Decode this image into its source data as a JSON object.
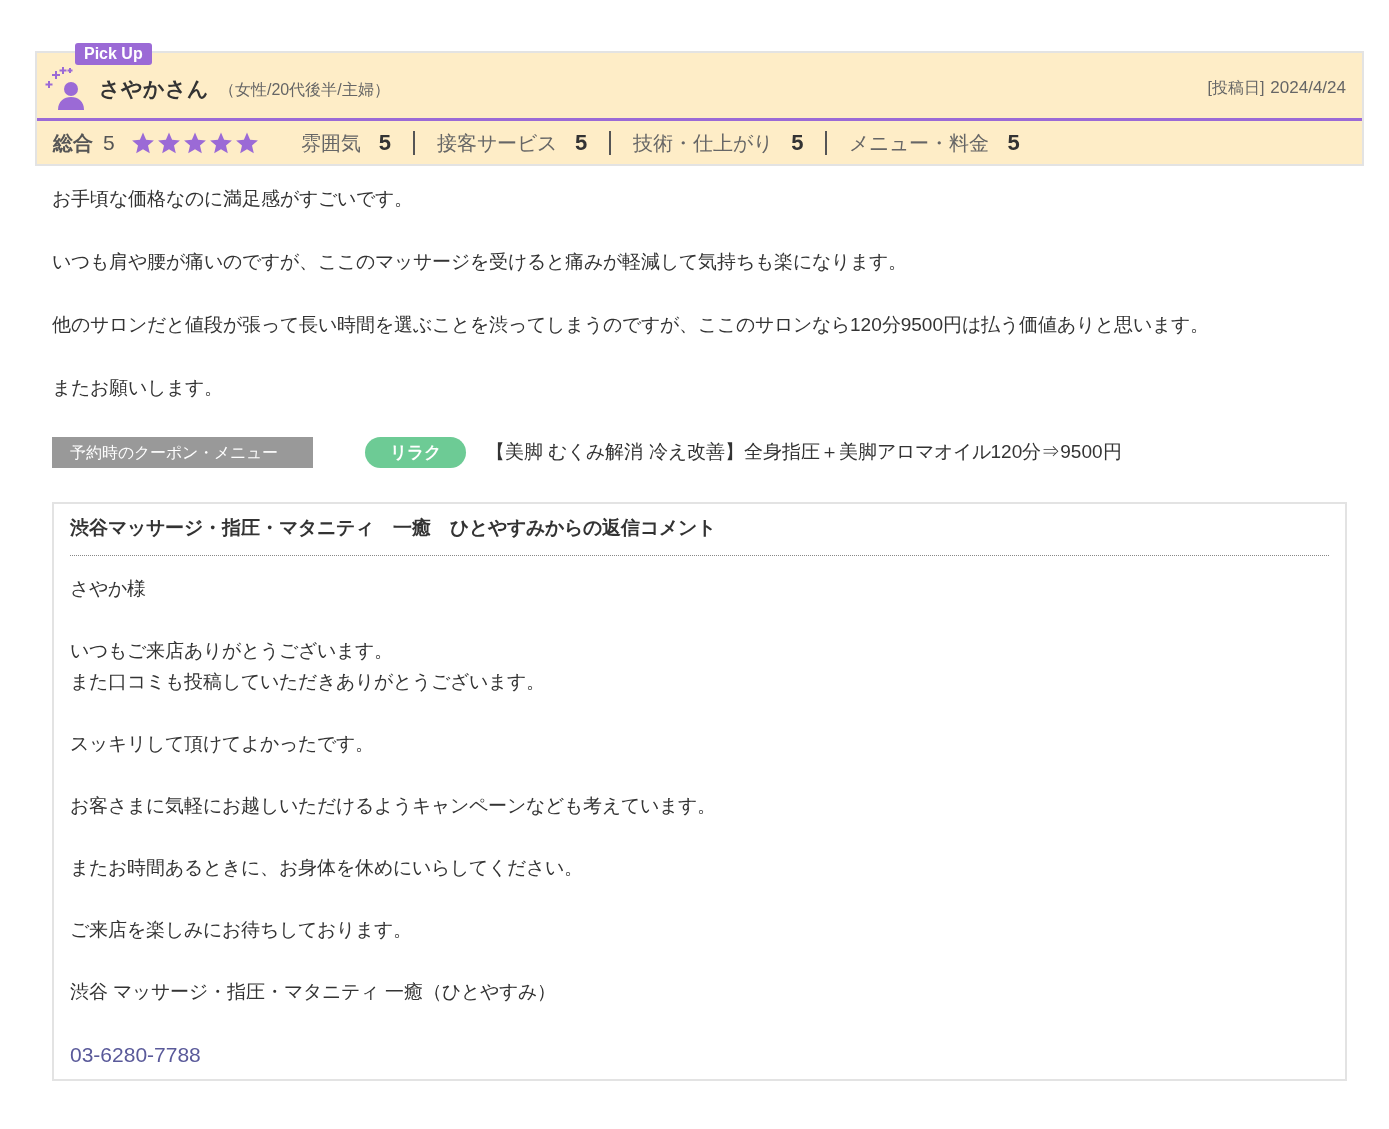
{
  "review": {
    "badge": "Pick Up",
    "name": "さやかさん",
    "profile": "（女性/20代後半/主婦）",
    "date_label": "[投稿日]",
    "date": "2024/4/24",
    "overall": {
      "label": "総合",
      "score": "5",
      "stars": 5
    },
    "ratings": [
      {
        "label": "雰囲気",
        "score": "5"
      },
      {
        "label": "接客サービス",
        "score": "5"
      },
      {
        "label": "技術・仕上がり",
        "score": "5"
      },
      {
        "label": "メニュー・料金",
        "score": "5"
      }
    ],
    "paragraphs": [
      "お手頃な価格なのに満足感がすごいです。",
      "いつも肩や腰が痛いのですが、ここのマッサージを受けると痛みが軽減して気持ちも楽になります。",
      "他のサロンだと値段が張って長い時間を選ぶことを渋ってしまうのですが、ここのサロンなら120分9500円は払う価値ありと思います。",
      "またお願いします。"
    ],
    "coupon": {
      "label": "予約時のクーポン・メニュー",
      "tag": "リラク",
      "text": "【美脚 むくみ解消 冷え改善】全身指圧＋美脚アロマオイル120分⇒9500円"
    }
  },
  "reply": {
    "title": "渋谷マッサージ・指圧・マタニティ　一癒　ひとやすみからの返信コメント",
    "paragraphs": [
      [
        "さやか様"
      ],
      [
        "いつもご来店ありがとうございます。",
        "また口コミも投稿していただきありがとうございます。"
      ],
      [
        "スッキリして頂けてよかったです。"
      ],
      [
        "お客さまに気軽にお越しいただけるようキャンペーンなども考えています。"
      ],
      [
        "またお時間あるときに、お身体を休めにいらしてください。"
      ],
      [
        "ご来店を楽しみにお待ちしております。"
      ],
      [
        "渋谷 マッサージ・指圧・マタニティ 一癒（ひとやすみ）"
      ]
    ],
    "phone": "03-6280-7788"
  }
}
